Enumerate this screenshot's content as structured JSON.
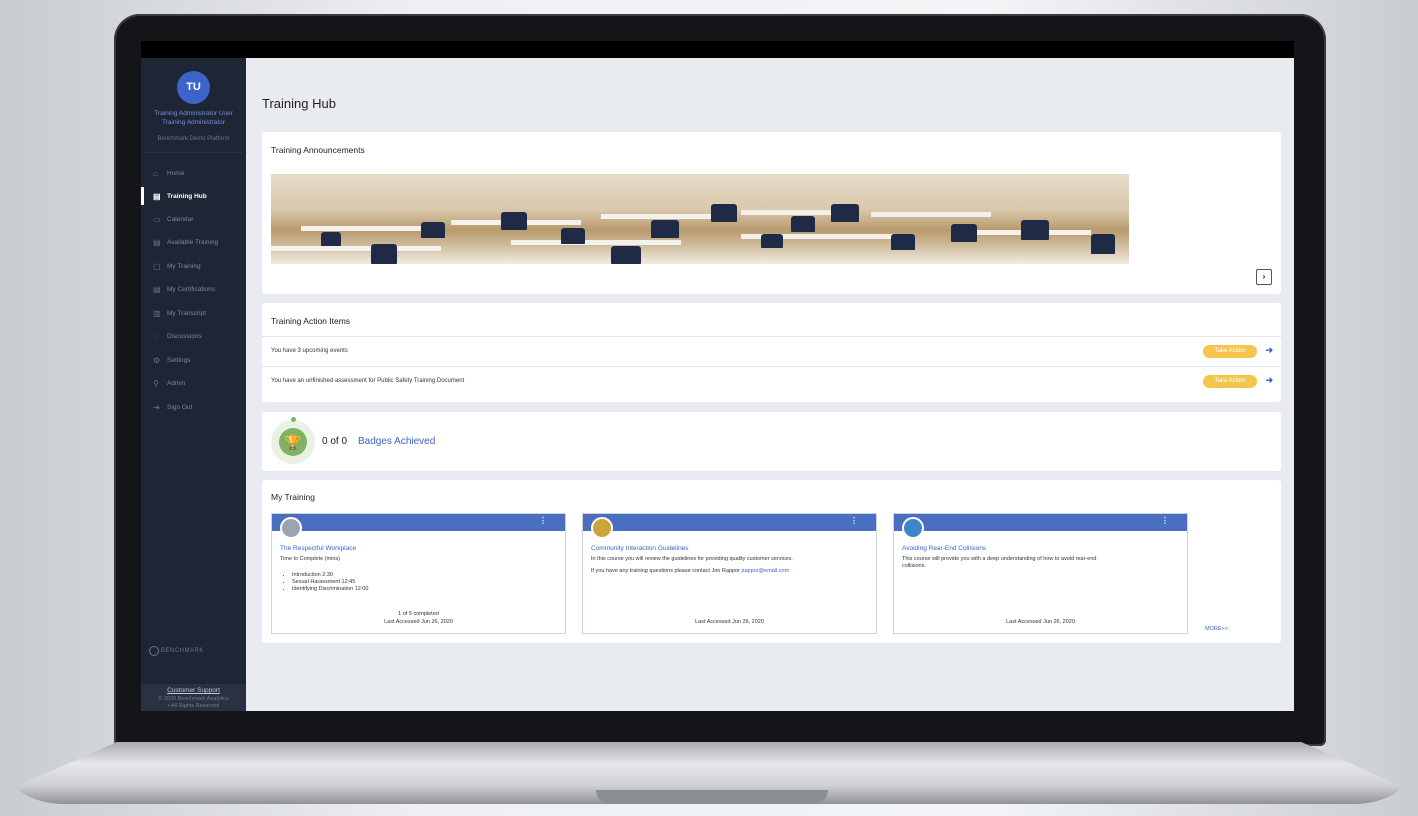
{
  "sidebar": {
    "avatar_initials": "TU",
    "user_name": "Training Administrator User",
    "user_role": "Training Administrator",
    "org": "Benchmark Demo Platform",
    "items": [
      {
        "label": "Home",
        "icon": "home-icon"
      },
      {
        "label": "Training Hub",
        "icon": "hub-icon",
        "active": true
      },
      {
        "label": "Calendar",
        "icon": "calendar-icon"
      },
      {
        "label": "Available Training",
        "icon": "available-training-icon"
      },
      {
        "label": "My Training",
        "icon": "my-training-icon"
      },
      {
        "label": "My Certifications",
        "icon": "certifications-icon"
      },
      {
        "label": "My Transcript",
        "icon": "transcript-icon"
      },
      {
        "label": "Discussions",
        "icon": "discussions-icon"
      },
      {
        "label": "Settings",
        "icon": "settings-icon"
      },
      {
        "label": "Admin",
        "icon": "admin-icon"
      },
      {
        "label": "Sign Out",
        "icon": "sign-out-icon"
      }
    ],
    "logo_text": "BENCHMARK",
    "support_link": "Customer Support",
    "copyright_line1": "© 2020 Benchmark Analytics",
    "copyright_line2": "• All Rights Reserved"
  },
  "main": {
    "page_title": "Training Hub",
    "announcements": {
      "title": "Training Announcements",
      "next_label": "›"
    },
    "action_items": {
      "title": "Training Action Items",
      "items": [
        {
          "text": "You have 3 upcoming events",
          "button": "Take Action"
        },
        {
          "text": "You have an unfinished assessment for Public Safety Training Document",
          "button": "Take Action"
        }
      ]
    },
    "badges": {
      "count": "0 of 0",
      "label": "Badges Achieved"
    },
    "my_training": {
      "title": "My Training",
      "more_label": "MORE>>",
      "courses": [
        {
          "title": "The Respectful Workplace",
          "subtitle": "Time to Complete (mins)",
          "items": [
            "Introduction 2:30",
            "Sexual Harassment 12:45",
            "Identifying Discrimination 12:00"
          ],
          "progress": "1 of 5 completed",
          "last_accessed": "Last Accessed Jun 26, 2020"
        },
        {
          "title": "Community Interaction Guidelines",
          "line1": "In this course you will review the guidelines for providing quality customer services.",
          "line2": "If you have any training questions please contact Jon Rappor",
          "email": "jrappor@email.com",
          "last_accessed": "Last Accessed Jun 26, 2020"
        },
        {
          "title": "Avoiding Rear-End Collisions",
          "line1": "This course will provide you with a deep understanding of how to avoid rear-end",
          "line2": "collisions.",
          "last_accessed": "Last Accessed Jun 26, 2020"
        }
      ]
    }
  },
  "colors": {
    "sidebar_bg": "#1e2534",
    "accent": "#3b63c9",
    "card_header": "#4a6fc0",
    "take_action": "#f5c64b",
    "badge_green": "#7fb263"
  }
}
